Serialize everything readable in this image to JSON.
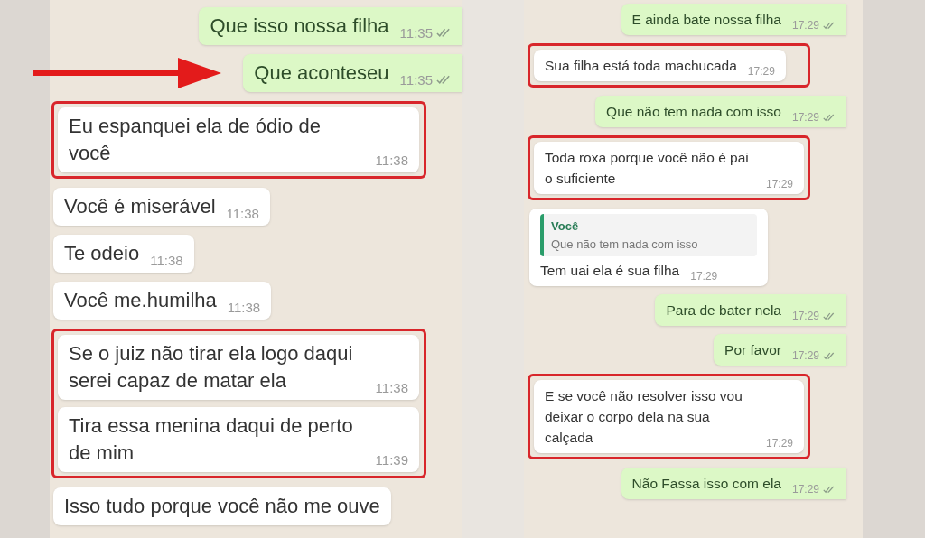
{
  "panels": [
    {
      "items": [
        {
          "kind": "sent",
          "text": "Que isso nossa filha",
          "time": "11:35"
        },
        {
          "kind": "sent",
          "text": "Que aconteseu",
          "time": "11:35",
          "arrow": true
        },
        {
          "kind": "highlight",
          "messages": [
            {
              "kind": "received",
              "text": "Eu espanquei ela de ódio de você",
              "time": "11:38"
            }
          ]
        },
        {
          "kind": "received",
          "text": "Você é miserável",
          "time": "11:38"
        },
        {
          "kind": "received",
          "text": "Te odeio",
          "time": "11:38"
        },
        {
          "kind": "received",
          "text": "Você me.humilha",
          "time": "11:38"
        },
        {
          "kind": "highlight",
          "messages": [
            {
              "kind": "received",
              "text": "Se o juiz não tirar ela logo daqui serei capaz de matar ela",
              "time": "11:38"
            },
            {
              "kind": "received",
              "text": "Tira essa menina daqui de perto de mim",
              "time": "11:39"
            }
          ]
        },
        {
          "kind": "received",
          "text": "Isso tudo porque você não me ouve"
        }
      ]
    },
    {
      "items": [
        {
          "kind": "sent",
          "text": "E ainda bate nossa filha",
          "time": "17:29"
        },
        {
          "kind": "highlight",
          "messages": [
            {
              "kind": "received",
              "text": "Sua filha está toda machucada",
              "time": "17:29"
            }
          ]
        },
        {
          "kind": "sent",
          "text": "Que não tem nada com isso",
          "time": "17:29"
        },
        {
          "kind": "highlight",
          "messages": [
            {
              "kind": "received",
              "text": "Toda roxa porque você não é pai o suficiente",
              "time": "17:29"
            }
          ]
        },
        {
          "kind": "received",
          "text": "Tem uai ela é sua filha",
          "time": "17:29",
          "quote": {
            "author": "Você",
            "text": "Que não tem nada com isso"
          }
        },
        {
          "kind": "sent",
          "text": "Para de bater nela",
          "time": "17:29"
        },
        {
          "kind": "sent",
          "text": "Por favor",
          "time": "17:29"
        },
        {
          "kind": "highlight",
          "messages": [
            {
              "kind": "received",
              "text": "E se você não resolver isso vou deixar o corpo dela na sua calçada",
              "time": "17:29"
            }
          ]
        },
        {
          "kind": "sent",
          "text": "Não Fassa isso com ela",
          "time": "17:29"
        }
      ]
    }
  ]
}
